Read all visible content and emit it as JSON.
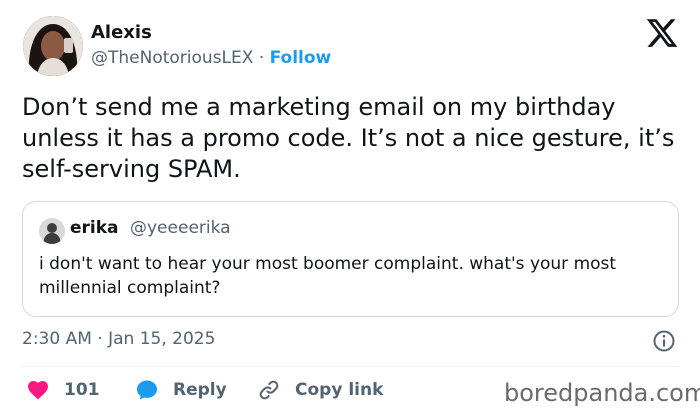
{
  "author": {
    "name": "Alexis",
    "handle": "@TheNotoriousLEX",
    "separator": "·",
    "follow_label": "Follow"
  },
  "tweet": {
    "text": "Don’t send me a marketing email on my birthday unless it has a promo code. It’s not a nice gesture, it’s self-serving SPAM.",
    "timestamp": "2:30 AM · Jan 15, 2025"
  },
  "quoted_tweet": {
    "name": "erika",
    "handle": "@yeeeerika",
    "text": "i don't want to hear your most boomer complaint. what's your most millennial complaint?"
  },
  "actions": {
    "like_count": "101",
    "reply_label": "Reply",
    "copy_link_label": "Copy link"
  },
  "watermark": "boredpanda.com",
  "icons": {
    "logo": "x-logo-icon",
    "info": "info-icon",
    "like": "heart-icon",
    "reply": "speech-bubble-icon",
    "copy": "link-icon"
  },
  "colors": {
    "accent": "#1d9bf0",
    "like": "#f91880",
    "text_primary": "#0f1419",
    "text_secondary": "#536471",
    "border": "#cfd9de"
  }
}
